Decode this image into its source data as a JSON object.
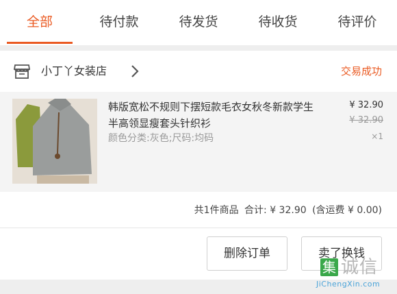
{
  "tabs": [
    {
      "label": "全部",
      "active": true
    },
    {
      "label": "待付款"
    },
    {
      "label": "待发货"
    },
    {
      "label": "待收货"
    },
    {
      "label": "待评价"
    }
  ],
  "order": {
    "shop_name": "小丁丫女装店",
    "status": "交易成功",
    "product": {
      "name": "韩版宽松不规则下摆短款毛衣女秋冬新款学生半高领显瘦套头针织衫",
      "spec": "颜色分类:灰色;尺码:均码",
      "price": "¥ 32.90",
      "original_price": "¥ 32.90",
      "quantity": "×1"
    },
    "summary": {
      "count_text": "共1件商品",
      "total_text": "合计: ¥ 32.90",
      "shipping_text": "(含运费 ¥ 0.00)"
    },
    "buttons": {
      "delete": "删除订单",
      "sell": "卖了换钱"
    }
  },
  "watermark": {
    "char": "集",
    "text": "诚信",
    "sub": "JiChengXin.com"
  },
  "colors": {
    "accent": "#ea5a22",
    "watermark_green": "#3aa84a"
  }
}
